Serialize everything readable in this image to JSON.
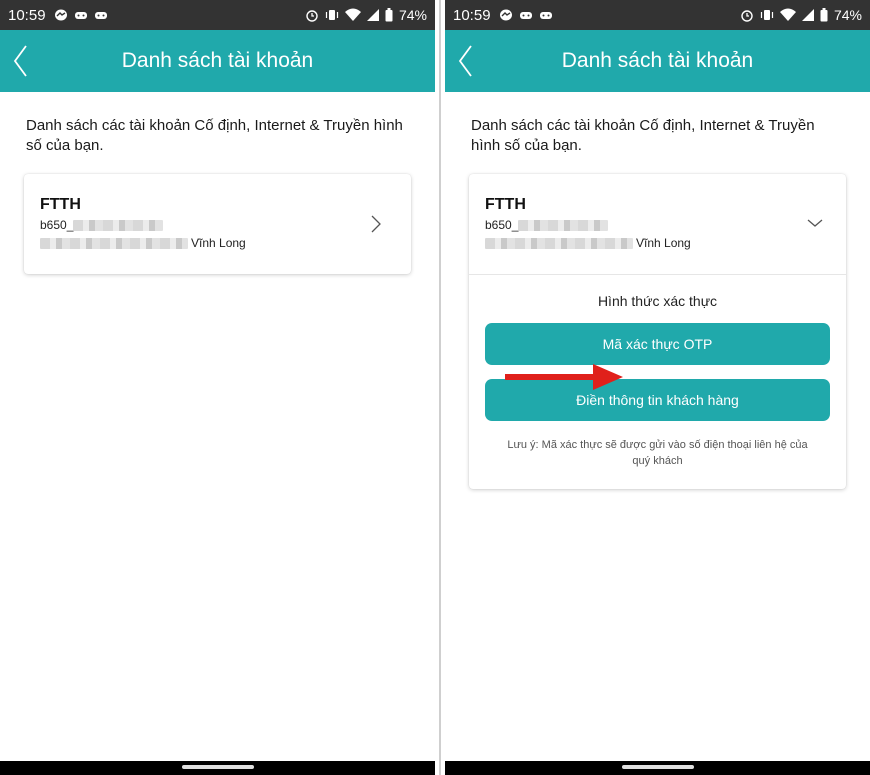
{
  "screens": [
    {
      "status": {
        "time": "10:59",
        "battery": "74%"
      },
      "header": {
        "title": "Danh sách tài khoản"
      },
      "description": "Danh sách các tài khoản Cố định, Internet & Truyền hình số của bạn.",
      "account": {
        "type": "FTTH",
        "id_prefix": "b650_",
        "location_suffix": "Vĩnh Long"
      }
    },
    {
      "status": {
        "time": "10:59",
        "battery": "74%"
      },
      "header": {
        "title": "Danh sách tài khoản"
      },
      "description": "Danh sách các tài khoản Cố định, Internet & Truyền hình số của bạn.",
      "account": {
        "type": "FTTH",
        "id_prefix": "b650_",
        "location_suffix": "Vĩnh Long"
      },
      "auth": {
        "title": "Hình thức xác thực",
        "otp_label": "Mã xác thực OTP",
        "customer_info_label": "Điền thông tin khách hàng",
        "note": "Lưu ý: Mã xác thực sẽ được gửi vào số điện thoại liên hệ của quý khách"
      }
    }
  ],
  "colors": {
    "accent": "#20a9ab",
    "status_bar": "#333333",
    "annotation_arrow": "#e0201b"
  },
  "icons": [
    "messenger-icon",
    "game-icon",
    "alarm-icon",
    "vibrate-icon",
    "wifi-icon",
    "signal-icon",
    "battery-icon",
    "back-icon",
    "chevron-right-icon",
    "chevron-down-icon",
    "red-arrow-icon"
  ]
}
